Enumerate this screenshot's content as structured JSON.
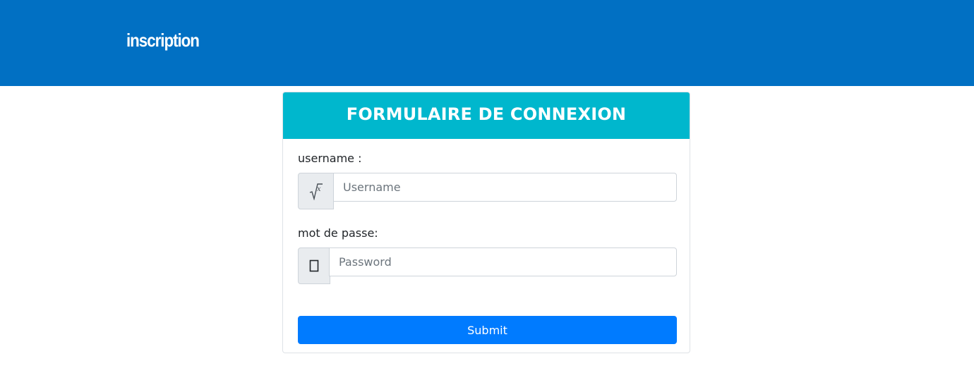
{
  "header": {
    "link_text": "inscription",
    "background": "#0170c3"
  },
  "form": {
    "title": "FORMULAIRE DE CONNEXION",
    "title_background": "#00b7cd",
    "username": {
      "label": "username :",
      "placeholder": "Username",
      "value": "",
      "icon": "sqrt-x-icon"
    },
    "password": {
      "label": "mot de passe:",
      "placeholder": "Password",
      "value": "",
      "icon": "missing-glyph-icon"
    },
    "submit_label": "Submit",
    "submit_color": "#007bff"
  }
}
